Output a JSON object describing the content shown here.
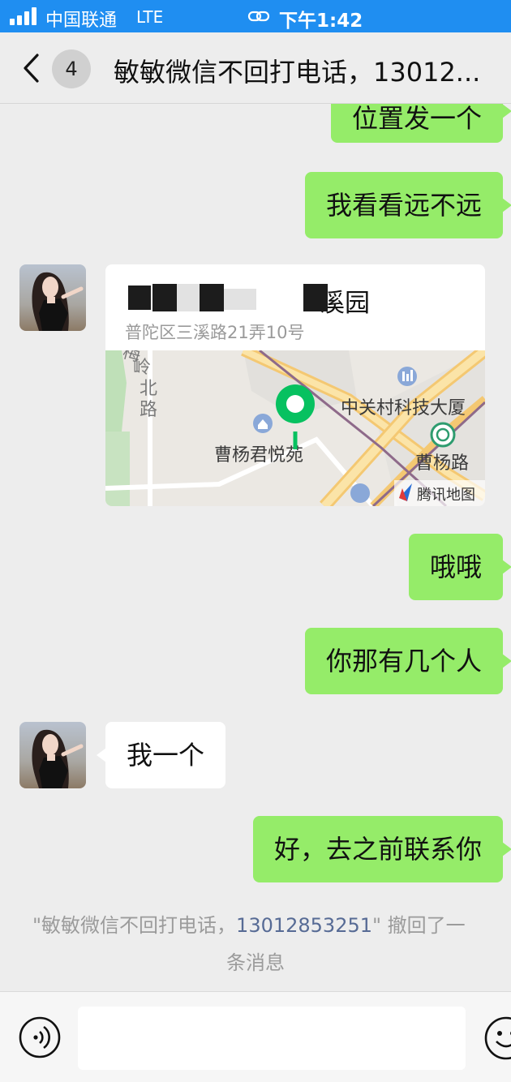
{
  "status_bar": {
    "carrier": "中国联通",
    "network": "LTE",
    "time": "下午1:42"
  },
  "nav": {
    "unread_count": "4",
    "title": "敏敏微信不回打电话，13012..."
  },
  "messages": [
    {
      "side": "right",
      "text": "位置发一个"
    },
    {
      "side": "right",
      "text": "我看看远不远"
    },
    {
      "side": "left",
      "type": "location",
      "name": "溪园",
      "address": "普陀区三溪路21弄10号",
      "map_labels": {
        "road_left": "梅岭北路",
        "poi_1": "曹杨君悦苑",
        "poi_2": "中关村科技大厦",
        "road_right": "曹杨路",
        "provider": "腾讯地图"
      }
    },
    {
      "side": "right",
      "text": "哦哦"
    },
    {
      "side": "right",
      "text": "你那有几个人"
    },
    {
      "side": "left",
      "text": "我一个"
    },
    {
      "side": "right",
      "text": "好，去之前联系你"
    }
  ],
  "system_notice": {
    "prefix": "\"敏敏微信不回打电话，",
    "phone": "13012853251",
    "suffix": "\" 撤回了一",
    "line2": "条消息"
  },
  "input_bar": {
    "voice_icon": "voice-icon",
    "emoji_icon": "emoji-icon"
  },
  "colors": {
    "status_bar": "#1f8ef1",
    "bubble_self": "#95ec69",
    "bubble_other": "#ffffff",
    "background": "#ededed",
    "link": "#576b95",
    "map_pin": "#07c160"
  }
}
